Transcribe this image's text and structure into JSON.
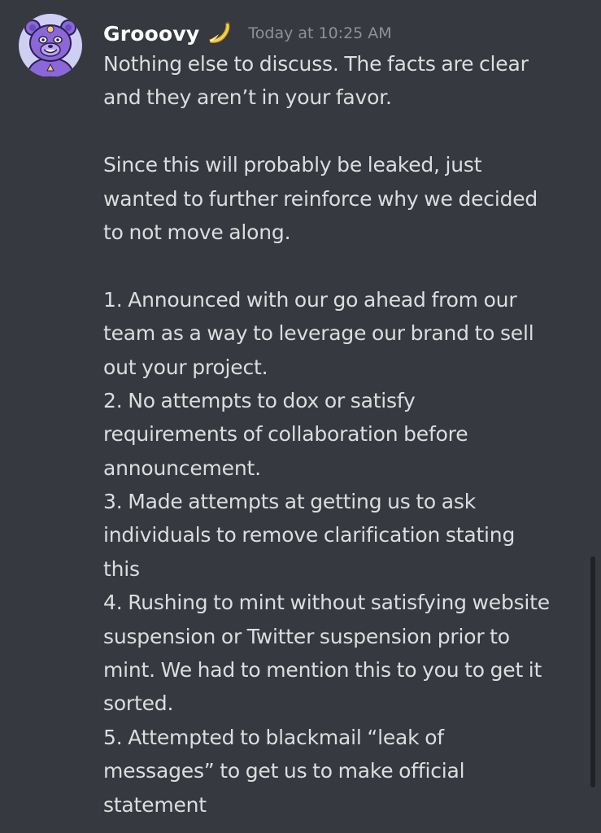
{
  "message": {
    "author": "Grooovy",
    "author_badge_icon": "banana-icon",
    "timestamp": "Today at 10:25 AM",
    "lines": [
      "Nothing else to discuss. The facts are clear",
      "and they aren’t in your favor.",
      "",
      "Since this will probably be leaked, just",
      "wanted to further reinforce why we decided",
      "to not move along.",
      "",
      "1. Announced with our go ahead from our",
      "team as a way to leverage our brand to sell",
      "out your project.",
      "2. No attempts to dox or satisfy",
      "requirements of collaboration before",
      "announcement.",
      "3. Made attempts at getting us to ask",
      "individuals to remove clarification stating",
      "this",
      "4. Rushing to mint without satisfying website",
      "suspension or Twitter suspension prior to",
      "mint. We had to mention this to you to get it",
      "sorted.",
      "5. Attempted to blackmail “leak of",
      "messages” to get us to make official",
      "statement"
    ]
  },
  "theme": {
    "background": "#36393f",
    "text": "#dcddde",
    "username": "#ffffff",
    "timestamp": "#8e9297",
    "avatar_bg": "#cfcff3",
    "avatar_bear": "#8b67d8",
    "scroll_thumb": "#202225"
  }
}
